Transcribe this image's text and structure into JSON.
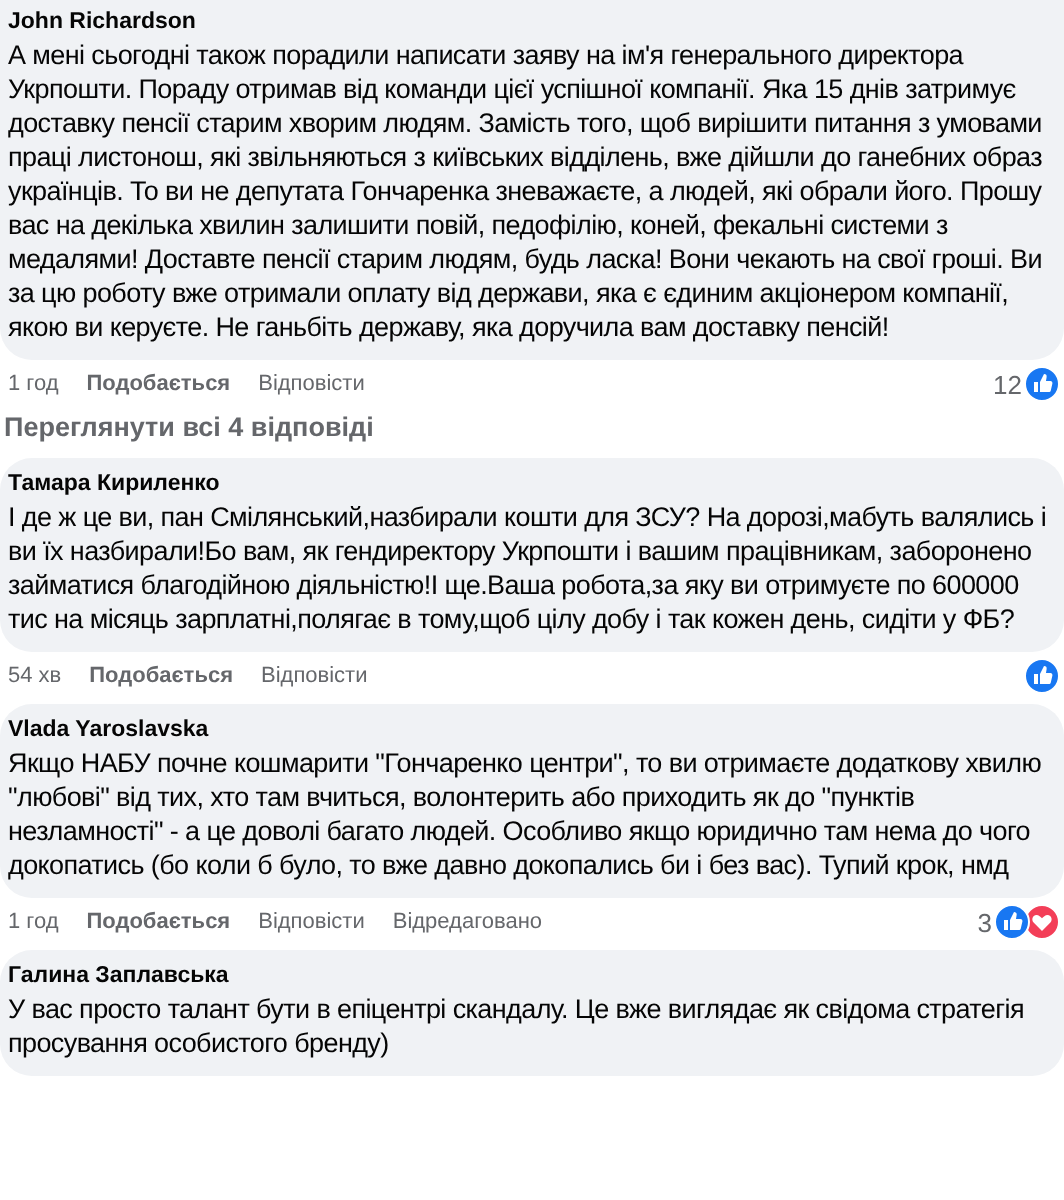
{
  "comments": [
    {
      "author": "John Richardson",
      "text": "А мені сьогодні також порадили написати заяву на ім'я генерального директора Укрпошти. Пораду отримав від команди цієї успішної компанії. Яка 15 днів затримує доставку пенсії старим хворим людям. Замість того, щоб вирішити питання з умовами праці листонош, які звільняються з київських відділень, вже дійшли до ганебних образ українців. То ви не депутата Гончаренка зневажаєте, а людей, які обрали його. Прошу вас на декілька хвилин залишити повій, педофілію, коней, фекальні системи з медалями! Доставте пенсії старим людям, будь ласка! Вони чекають на свої гроші. Ви за цю роботу вже отримали оплату від держави, яка є єдиним акціонером компанії, якою ви керуєте. Не ганьбіть державу, яка доручила вам доставку пенсій!",
      "time": "1 год",
      "like": "Подобається",
      "reply": "Відповісти",
      "reaction_count": "12",
      "reactions": [
        {
          "kind": "like"
        }
      ],
      "view_replies": "Переглянути всі 4 відповіді"
    },
    {
      "author": "Тамара Кириленко",
      "text": "І де ж це ви, пан Смілянський,назбирали кошти для ЗСУ? На дорозі,мабуть валялись і ви їх назбирали!Бо вам, як гендиректору Укрпошти і вашим працівникам, заборонено займатися благодійною діяльністю!І ще.Ваша робота,за яку ви отримуєте по 600000 тис на місяць зарплатні,полягає в тому,щоб цілу добу і так кожен день, сидіти у ФБ?",
      "time": "54 хв",
      "like": "Подобається",
      "reply": "Відповісти",
      "reactions": [
        {
          "kind": "like"
        }
      ]
    },
    {
      "author": "Vlada Yaroslavska",
      "text": "Якщо НАБУ почне кошмарити \"Гончаренко центри\", то ви отримаєте додаткову хвилю \"любові\" від тих, хто там вчиться, волонтерить або приходить як до \"пунктів незламності\" - а це доволі багато людей. Особливо якщо юридично там нема до чого докопатись (бо коли б було, то вже давно докопались би і без вас). Тупий крок, нмд",
      "time": "1 год",
      "like": "Подобається",
      "reply": "Відповісти",
      "edited": "Відредаговано",
      "reaction_count": "3",
      "reactions": [
        {
          "kind": "like"
        },
        {
          "kind": "love"
        }
      ]
    },
    {
      "author": "Галина Заплавська",
      "text": "У вас просто талант бути в епіцентрі скандалу. Це вже виглядає як свідома стратегія просування особистого бренду)"
    }
  ]
}
